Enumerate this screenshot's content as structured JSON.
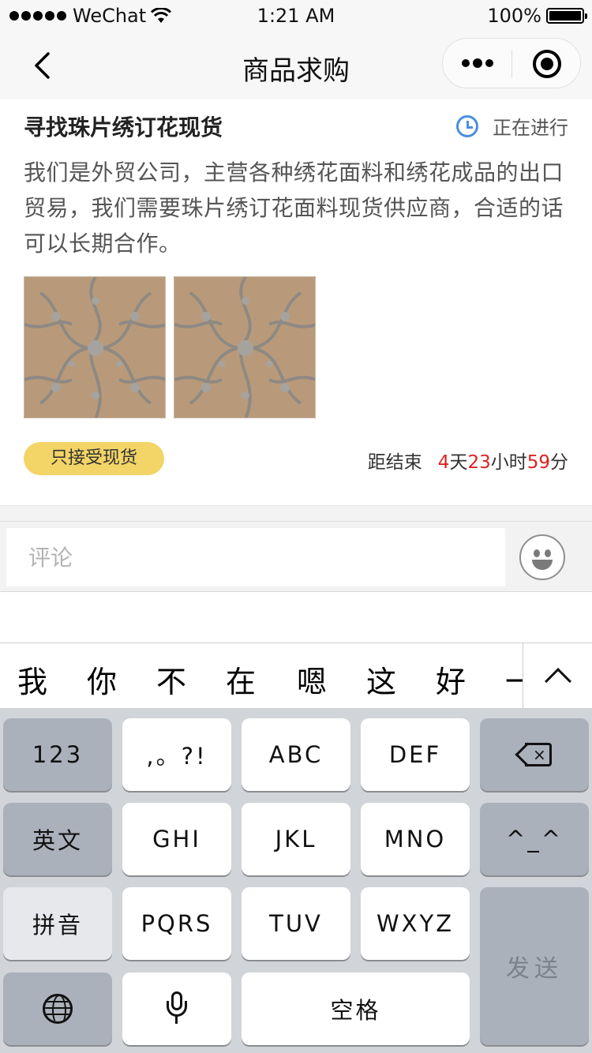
{
  "status_bar": {
    "carrier": "WeChat",
    "time": "1:21 AM",
    "battery": "100%"
  },
  "nav": {
    "title": "商品求购"
  },
  "post": {
    "title": "寻找珠片绣订花现货",
    "status": "正在进行",
    "description": "我们是外贸公司，主营各种绣花面料和绣花成品的出口贸易，我们需要珠片绣订花面料现货供应商，合适的话可以长期合作。",
    "tag": "只接受现货",
    "countdown": {
      "label": "距结束",
      "days": "4",
      "days_unit": "天",
      "hours": "23",
      "hours_unit": "小时",
      "minutes": "59",
      "minutes_unit": "分"
    }
  },
  "comment": {
    "placeholder": "评论"
  },
  "candidates": [
    "我",
    "你",
    "不",
    "在",
    "嗯",
    "这",
    "好",
    "一"
  ],
  "keyboard": {
    "k_123": "123",
    "k_punct": ",。?!",
    "k_abc": "ABC",
    "k_def": "DEF",
    "k_english": "英文",
    "k_ghi": "GHI",
    "k_jkl": "JKL",
    "k_mno": "MNO",
    "k_emoticon": "^_^",
    "k_pinyin": "拼音",
    "k_pqrs": "PQRS",
    "k_tuv": "TUV",
    "k_wxyz": "WXYZ",
    "k_send": "发送",
    "k_space": "空格"
  },
  "colors": {
    "accent_red": "#e02020",
    "tag_yellow": "#f3d466",
    "clock_blue": "#4a8fe0"
  }
}
